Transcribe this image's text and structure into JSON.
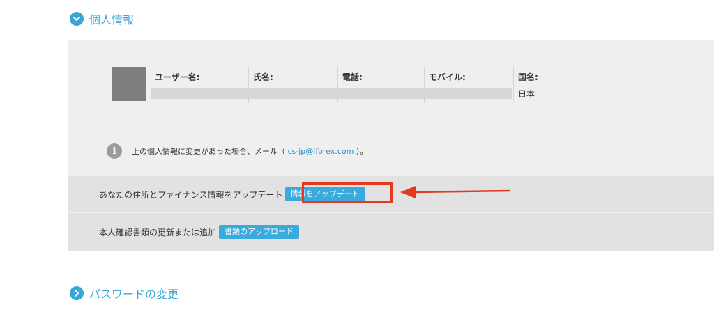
{
  "sections": {
    "personal_info_title": "個人情報",
    "password_title": "パスワードの変更"
  },
  "profile": {
    "fields": [
      {
        "label": "ユーザー名:",
        "value": ""
      },
      {
        "label": "氏名:",
        "value": ""
      },
      {
        "label": "電話:",
        "value": ""
      },
      {
        "label": "モバイル:",
        "value": ""
      },
      {
        "label": "国名:",
        "value": "日本"
      }
    ]
  },
  "notice": {
    "text_before": "上の個人情報に変更があった場合、メール（",
    "email": "cs-jp@iforex.com",
    "text_after": "）。"
  },
  "actions": {
    "update_text": "あなたの住所とファイナンス情報をアップデート",
    "update_button": "情報をアップデート",
    "docs_text": "本人確認書類の更新または追加",
    "docs_button": "書類のアップロード"
  },
  "colors": {
    "accent": "#39a6d6",
    "highlight": "#e23a1f",
    "button": "#3aa9dc"
  }
}
